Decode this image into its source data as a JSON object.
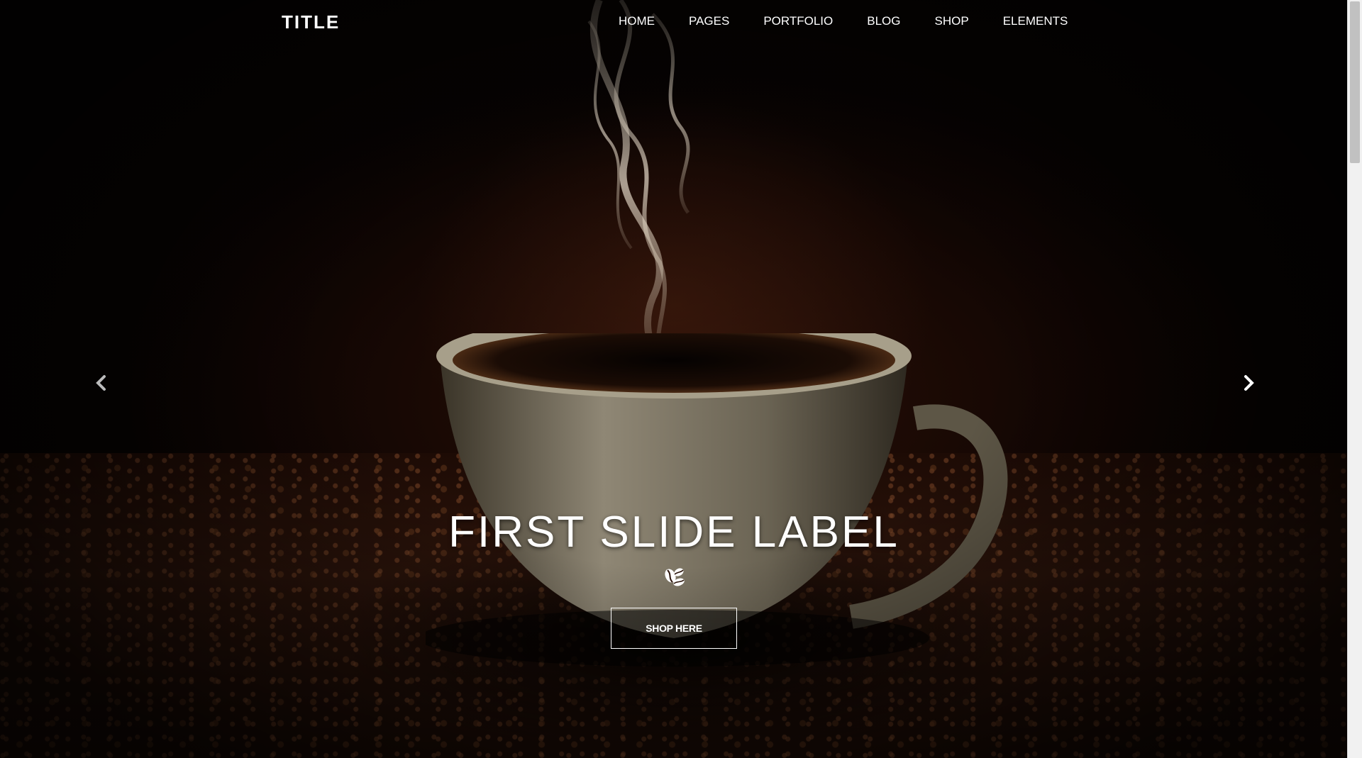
{
  "brand": {
    "title": "TITLE"
  },
  "nav": {
    "items": [
      {
        "label": "HOME"
      },
      {
        "label": "PAGES"
      },
      {
        "label": "PORTFOLIO"
      },
      {
        "label": "BLOG"
      },
      {
        "label": "SHOP"
      },
      {
        "label": "ELEMENTS"
      }
    ]
  },
  "carousel": {
    "caption": "FIRST SLIDE LABEL",
    "button_label": "SHOP HERE",
    "prev_icon": "chevron-left-icon",
    "next_icon": "chevron-right-icon",
    "divider_icon": "coffee-bean-icon"
  },
  "colors": {
    "text": "#ffffff",
    "background": "#120603"
  }
}
